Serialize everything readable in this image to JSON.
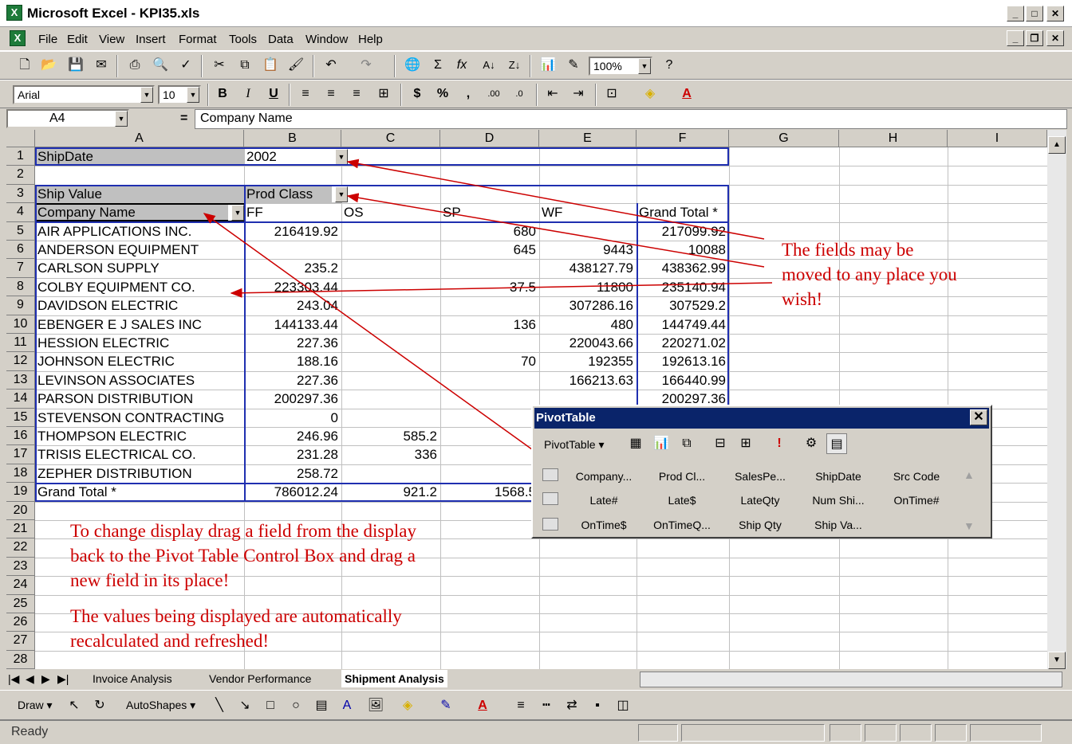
{
  "window": {
    "title": "Microsoft Excel - KPI35.xls"
  },
  "menu": [
    "File",
    "Edit",
    "View",
    "Insert",
    "Format",
    "Tools",
    "Data",
    "Window",
    "Help"
  ],
  "standard_toolbar": {
    "zoom": "100%"
  },
  "format_toolbar": {
    "font": "Arial",
    "size": "10",
    "bold": "B",
    "italic": "I",
    "underline": "U"
  },
  "formula_bar": {
    "namebox": "A4",
    "equals": "=",
    "content": "Company Name"
  },
  "columns": [
    "A",
    "B",
    "C",
    "D",
    "E",
    "F",
    "G",
    "H",
    "I"
  ],
  "rows": [
    "1",
    "2",
    "3",
    "4",
    "5",
    "6",
    "7",
    "8",
    "9",
    "10",
    "11",
    "12",
    "13",
    "14",
    "15",
    "16",
    "17",
    "18",
    "19",
    "20",
    "21",
    "22",
    "23",
    "24",
    "25",
    "26",
    "27",
    "28"
  ],
  "pivot_report": {
    "page_field": "ShipDate",
    "page_value": "2002",
    "data_field": "Ship Value",
    "col_field": "Prod Class",
    "row_field": "Company Name",
    "col_items": [
      "FF",
      "OS",
      "SP",
      "WF",
      "Grand Total *"
    ],
    "rows": [
      [
        "AIR APPLICATIONS INC.",
        "216419.92",
        "",
        "680",
        "",
        "217099.92"
      ],
      [
        "ANDERSON EQUIPMENT",
        "",
        "",
        "645",
        "9443",
        "10088"
      ],
      [
        "CARLSON SUPPLY",
        "235.2",
        "",
        "",
        "438127.79",
        "438362.99"
      ],
      [
        "COLBY EQUIPMENT CO.",
        "223303.44",
        "",
        "37.5",
        "11800",
        "235140.94"
      ],
      [
        "DAVIDSON ELECTRIC",
        "243.04",
        "",
        "",
        "307286.16",
        "307529.2"
      ],
      [
        "EBENGER E J SALES INC",
        "144133.44",
        "",
        "136",
        "480",
        "144749.44"
      ],
      [
        "HESSION ELECTRIC",
        "227.36",
        "",
        "",
        "220043.66",
        "220271.02"
      ],
      [
        "JOHNSON ELECTRIC",
        "188.16",
        "",
        "70",
        "192355",
        "192613.16"
      ],
      [
        "LEVINSON ASSOCIATES",
        "227.36",
        "",
        "",
        "166213.63",
        "166440.99"
      ],
      [
        "PARSON DISTRIBUTION",
        "200297.36",
        "",
        "",
        "",
        "200297.36"
      ],
      [
        "STEVENSON CONTRACTING",
        "0",
        "",
        "",
        "",
        ""
      ],
      [
        "THOMPSON ELECTRIC",
        "246.96",
        "585.2",
        "",
        "",
        ""
      ],
      [
        "TRISIS ELECTRICAL CO.",
        "231.28",
        "336",
        "",
        "",
        ""
      ],
      [
        "ZEPHER DISTRIBUTION",
        "258.72",
        "",
        "",
        "",
        ""
      ]
    ],
    "grand_total": [
      "Grand Total *",
      "786012.24",
      "921.2",
      "1568.5",
      "",
      ""
    ]
  },
  "annotations": {
    "right_note": [
      "The fields may be",
      "moved to any place you",
      "wish!"
    ],
    "bottom_note_1": [
      "To change display drag a field from the display",
      "back to the Pivot Table Control Box and drag a",
      "new field in its place!"
    ],
    "bottom_note_2": [
      "The values being displayed are automatically",
      "recalculated and refreshed!"
    ]
  },
  "pivot_toolbar": {
    "title": "PivotTable",
    "menu": "PivotTable",
    "fields": [
      "Company...",
      "Prod Cl...",
      "SalesPe...",
      "ShipDate",
      "Src Code",
      "Late#",
      "Late$",
      "LateQty",
      "Num Shi...",
      "OnTime#",
      "OnTime$",
      "OnTimeQ...",
      "Ship Qty",
      "Ship Va..."
    ]
  },
  "sheet_tabs": [
    "Invoice Analysis",
    "Vendor Performance",
    "Shipment Analysis"
  ],
  "drawing_toolbar": {
    "draw": "Draw",
    "autoshapes": "AutoShapes"
  },
  "status": {
    "text": "Ready"
  },
  "colors": {
    "accent_red": "#cc0000",
    "pivot_border": "#1f2fb0",
    "titlebar": "#0a246a"
  }
}
